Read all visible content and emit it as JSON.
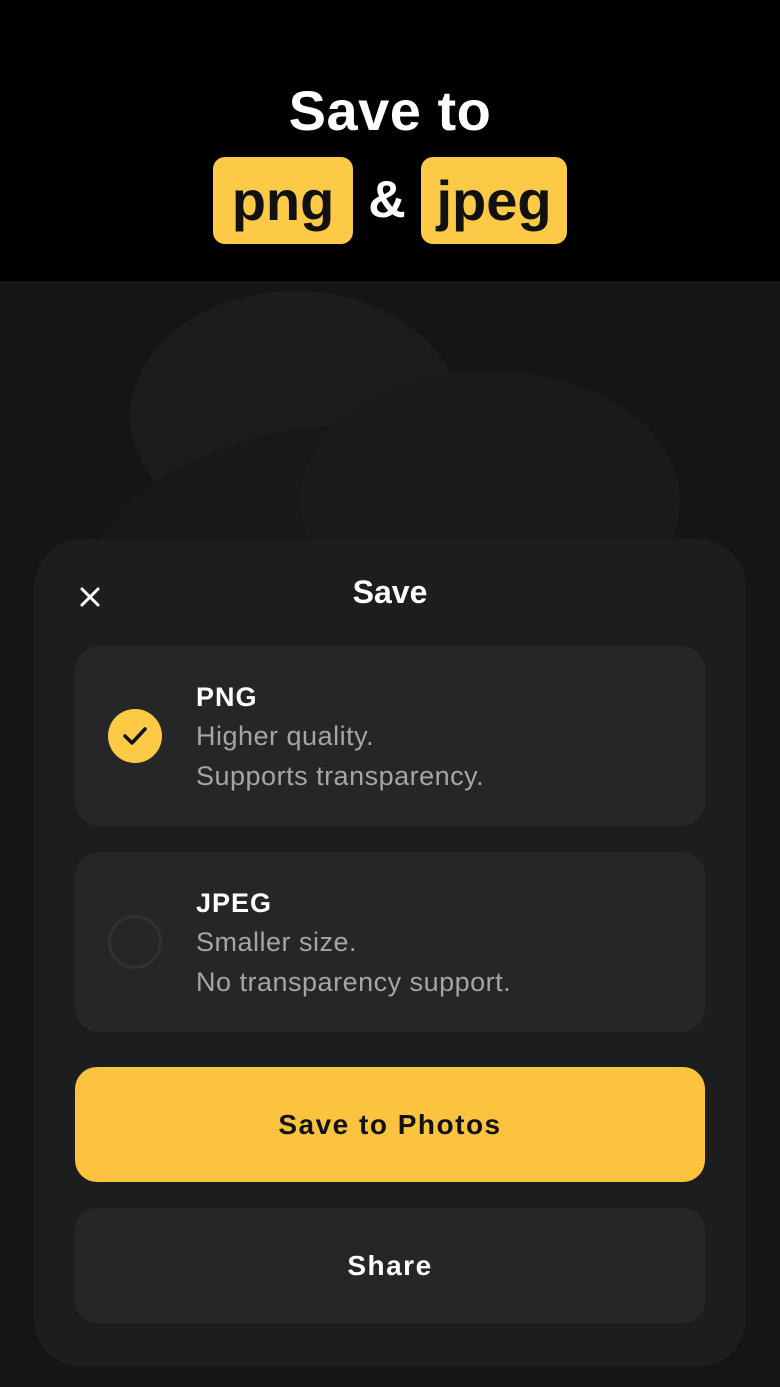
{
  "header": {
    "line1": "Save to",
    "pill_png": "png",
    "ampersand": "&",
    "pill_jpeg": "jpeg"
  },
  "sheet": {
    "title": "Save",
    "close_icon": "close-icon",
    "options": [
      {
        "title": "PNG",
        "line1": "Higher quality.",
        "line2": "Supports transparency.",
        "selected": true
      },
      {
        "title": "JPEG",
        "line1": "Smaller size.",
        "line2": "No transparency support.",
        "selected": false
      }
    ],
    "save_button_label": "Save to Photos",
    "share_button_label": "Share"
  },
  "colors": {
    "accent": "#fcc33f",
    "sheet_bg": "#1c1d1f",
    "card_bg": "#252628",
    "text_secondary": "#a3a5a8"
  }
}
